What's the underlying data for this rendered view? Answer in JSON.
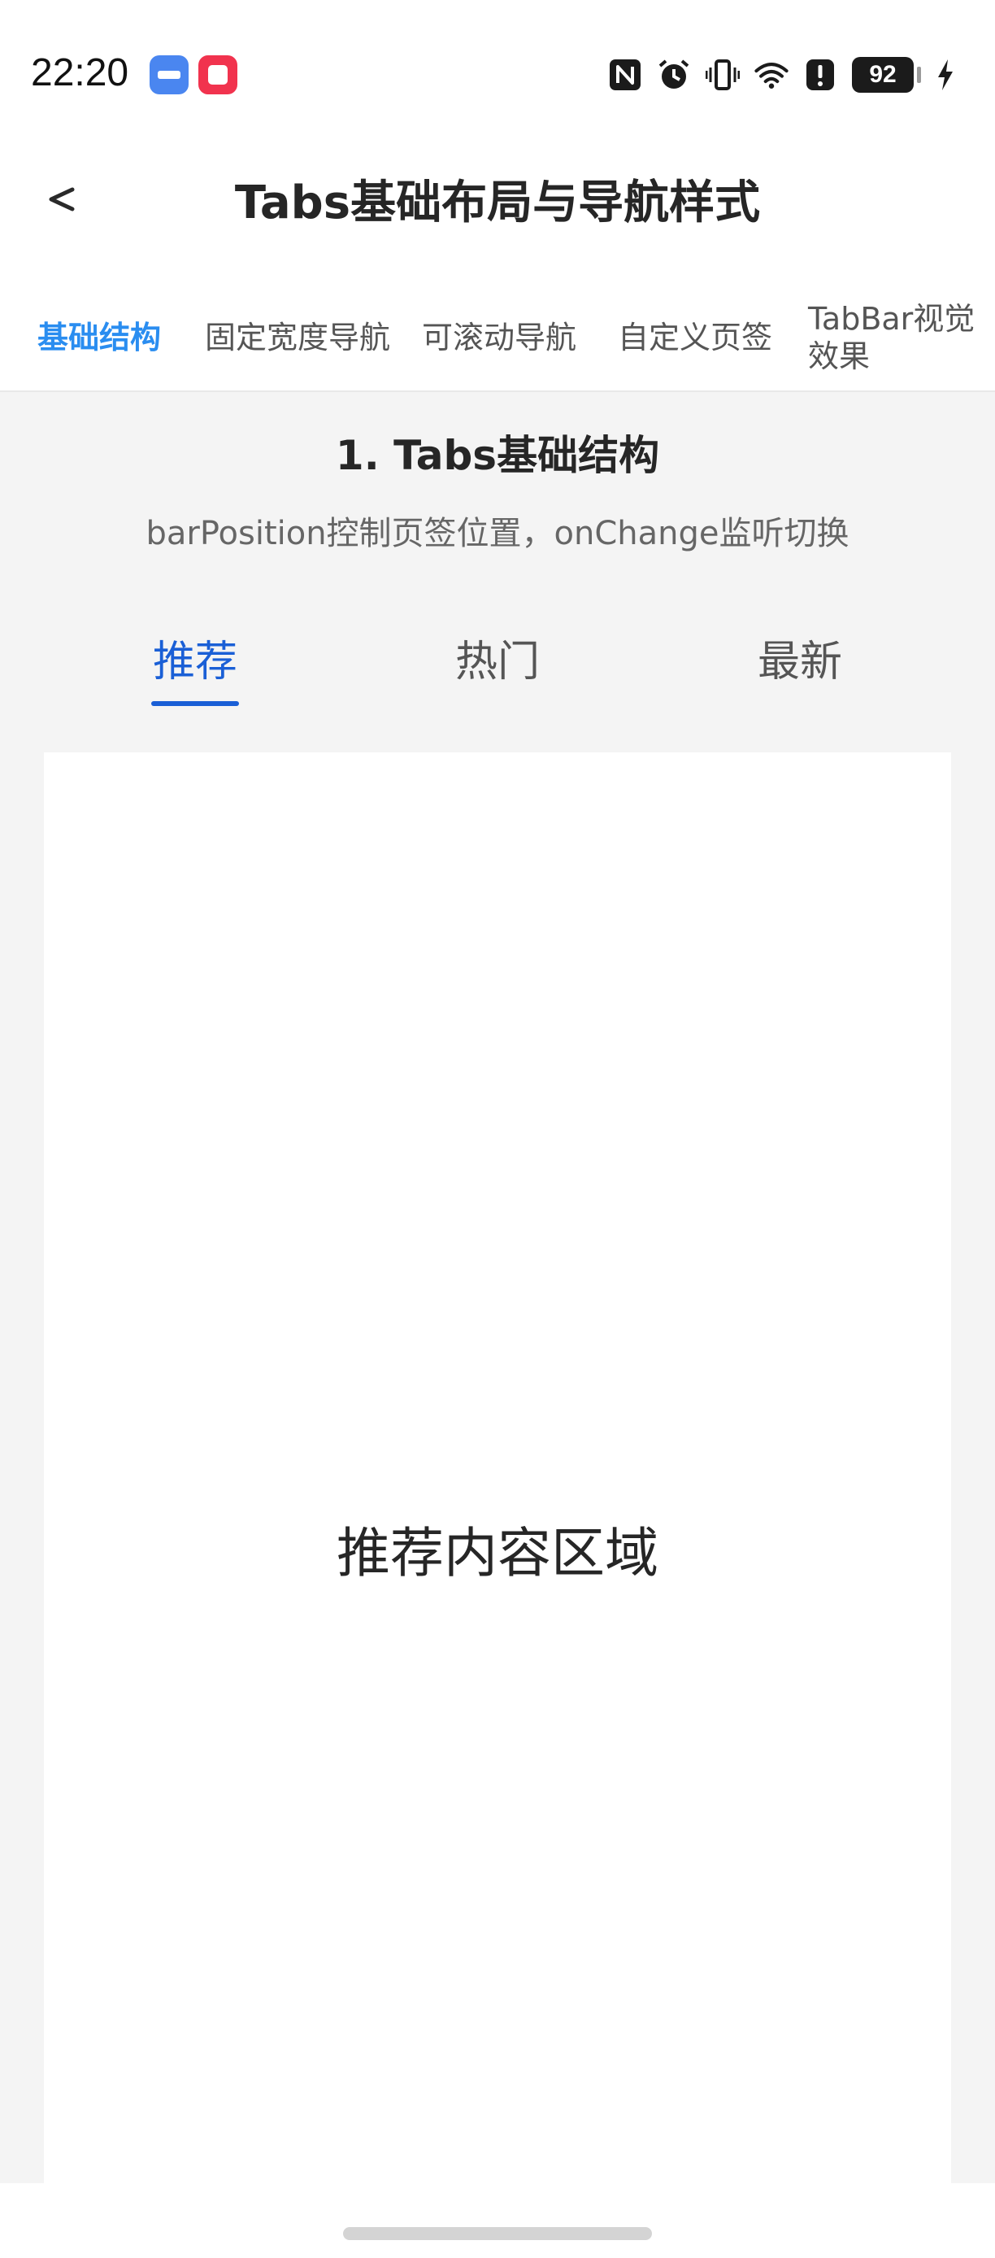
{
  "status_bar": {
    "time": "22:20",
    "battery_level": "92",
    "icons": [
      "usb-icon",
      "app-icon",
      "nfc-icon",
      "alarm-icon",
      "vibrate-icon",
      "wifi-icon",
      "alert-icon",
      "battery-icon",
      "charging-icon"
    ]
  },
  "header": {
    "back_label": "<",
    "title": "Tabs基础布局与导航样式"
  },
  "nav_tabs": [
    {
      "label": "基础结构",
      "active": true
    },
    {
      "label": "固定宽度导航",
      "active": false
    },
    {
      "label": "可滚动导航",
      "active": false
    },
    {
      "label": "自定义页签",
      "active": false
    },
    {
      "label": "TabBar视觉效果",
      "active": false
    }
  ],
  "section": {
    "title": "1. Tabs基础结构",
    "subtitle": "barPosition控制页签位置，onChange监听切换"
  },
  "inner_tabs": [
    {
      "label": "推荐",
      "active": true
    },
    {
      "label": "热门",
      "active": false
    },
    {
      "label": "最新",
      "active": false
    }
  ],
  "content": {
    "label": "推荐内容区域"
  },
  "colors": {
    "accent": "#2a8df0",
    "inner_tab_active": "#1a5fd6",
    "background": "#f4f4f4",
    "panel": "#ffffff"
  }
}
